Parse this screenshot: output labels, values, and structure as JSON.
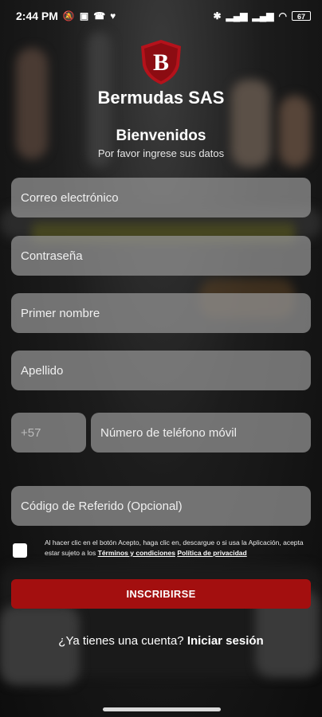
{
  "status": {
    "time": "2:44 PM",
    "battery": "67"
  },
  "brand": {
    "logo_letter": "B",
    "name": "Bermudas SAS"
  },
  "heading": {
    "title": "Bienvenidos",
    "subtitle": "Por favor ingrese sus datos"
  },
  "form": {
    "email_placeholder": "Correo electrónico",
    "password_placeholder": "Contraseña",
    "first_name_placeholder": "Primer nombre",
    "last_name_placeholder": "Apellido",
    "country_code": "+57",
    "phone_placeholder": "Número de teléfono móvil",
    "referral_placeholder": "Código de Referido (Opcional)"
  },
  "terms": {
    "text": "Al hacer clic en el botón Acepto, haga clic en, descargue o si usa la Aplicación, acepta estar sujeto a los",
    "terms_link": "Términos y condiciones",
    "privacy_link": "Política de privacidad"
  },
  "actions": {
    "signup_label": "INSCRIBIRSE",
    "have_account": "¿Ya tienes una cuenta?",
    "login_label": "Iniciar sesión"
  },
  "colors": {
    "accent": "#a30f0f",
    "field_bg": "#969696"
  }
}
